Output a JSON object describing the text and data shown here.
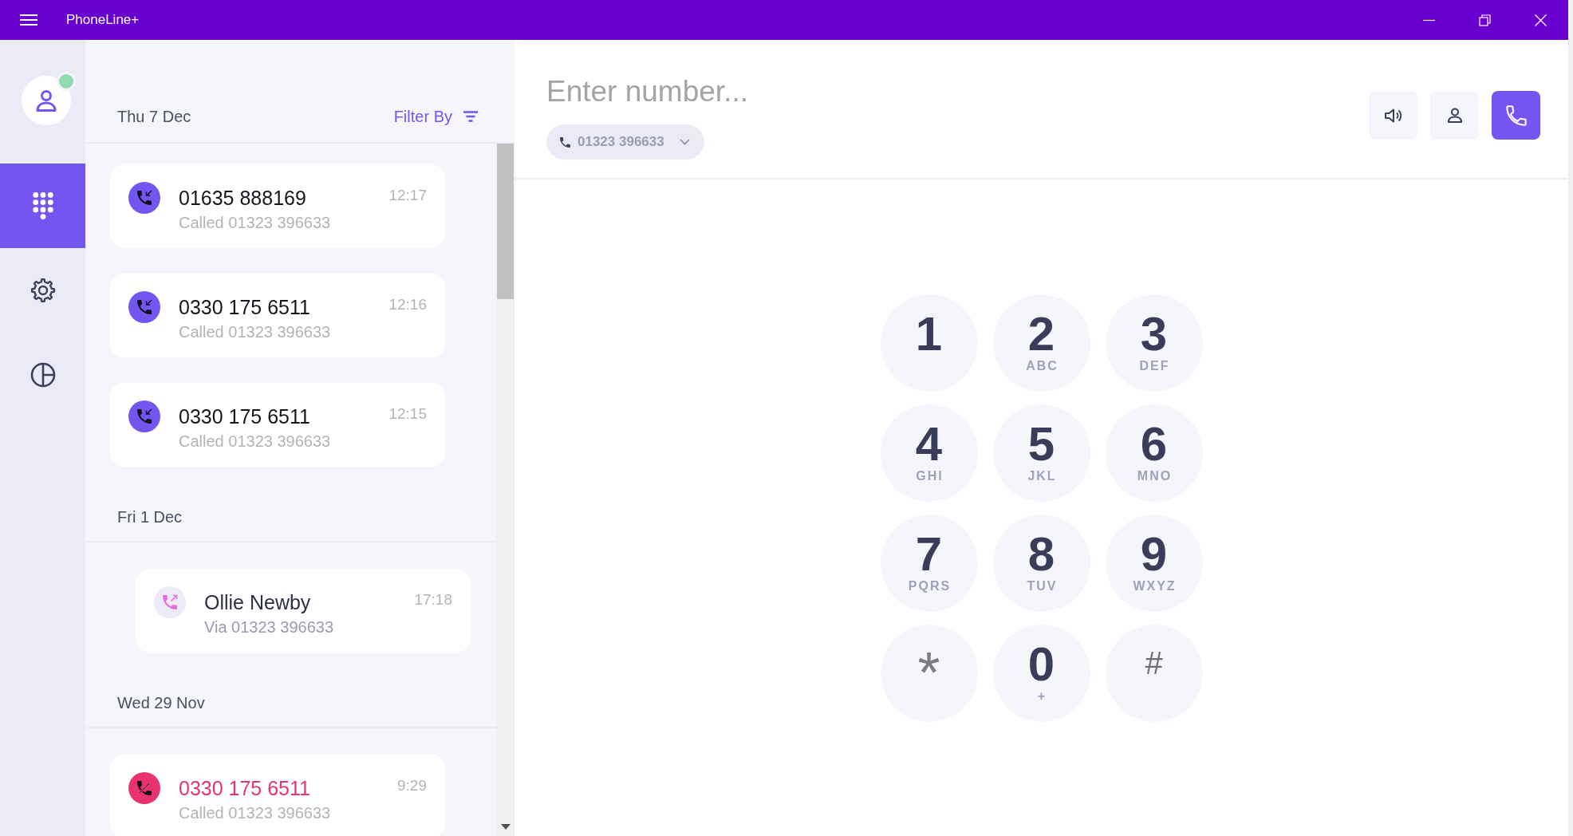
{
  "window": {
    "title": "PhoneLine+"
  },
  "profile": {
    "online": true
  },
  "nav": {
    "items": [
      {
        "kind": "dialpad",
        "selected": true
      },
      {
        "kind": "settings",
        "selected": false
      },
      {
        "kind": "stats",
        "selected": false
      }
    ]
  },
  "call_log": {
    "filter": {
      "label": "Filter By"
    },
    "groups": [
      {
        "date": "Thu 7 Dec",
        "calls": [
          {
            "kind": "incoming",
            "name": "01635 888169",
            "detail": "Called 01323 396633",
            "time": "12:17"
          },
          {
            "kind": "incoming",
            "name": "0330 175 6511",
            "detail": "Called 01323 396633",
            "time": "12:16"
          },
          {
            "kind": "incoming",
            "name": "0330 175 6511",
            "detail": "Called 01323 396633",
            "time": "12:15"
          }
        ]
      },
      {
        "date": "Fri 1 Dec",
        "calls": [
          {
            "kind": "outgoing",
            "name": "Ollie Newby",
            "detail": "Via 01323 396633",
            "time": "17:18"
          }
        ]
      },
      {
        "date": "Wed 29 Nov",
        "calls": [
          {
            "kind": "missed",
            "name": "0330 175 6511",
            "detail": "Called 01323 396633",
            "time": "9:29"
          }
        ]
      }
    ]
  },
  "dialer": {
    "number": {
      "placeholder": "Enter number..."
    },
    "line": "01323 396633",
    "keys": [
      {
        "kind": "digit",
        "digit": "1"
      },
      {
        "kind": "digit",
        "digit": "2",
        "letters": "ABC"
      },
      {
        "kind": "digit",
        "digit": "3",
        "letters": "DEF"
      },
      {
        "kind": "digit",
        "digit": "4",
        "letters": "GHI"
      },
      {
        "kind": "digit",
        "digit": "5",
        "letters": "JKL"
      },
      {
        "kind": "digit",
        "digit": "6",
        "letters": "MNO"
      },
      {
        "kind": "digit",
        "digit": "7",
        "letters": "PQRS"
      },
      {
        "kind": "digit",
        "digit": "8",
        "letters": "TUV"
      },
      {
        "kind": "digit",
        "digit": "9",
        "letters": "WXYZ"
      },
      {
        "kind": "star",
        "digit": "*"
      },
      {
        "kind": "digit",
        "digit": "0",
        "letters": "+"
      },
      {
        "kind": "hash",
        "digit": "#"
      }
    ]
  }
}
